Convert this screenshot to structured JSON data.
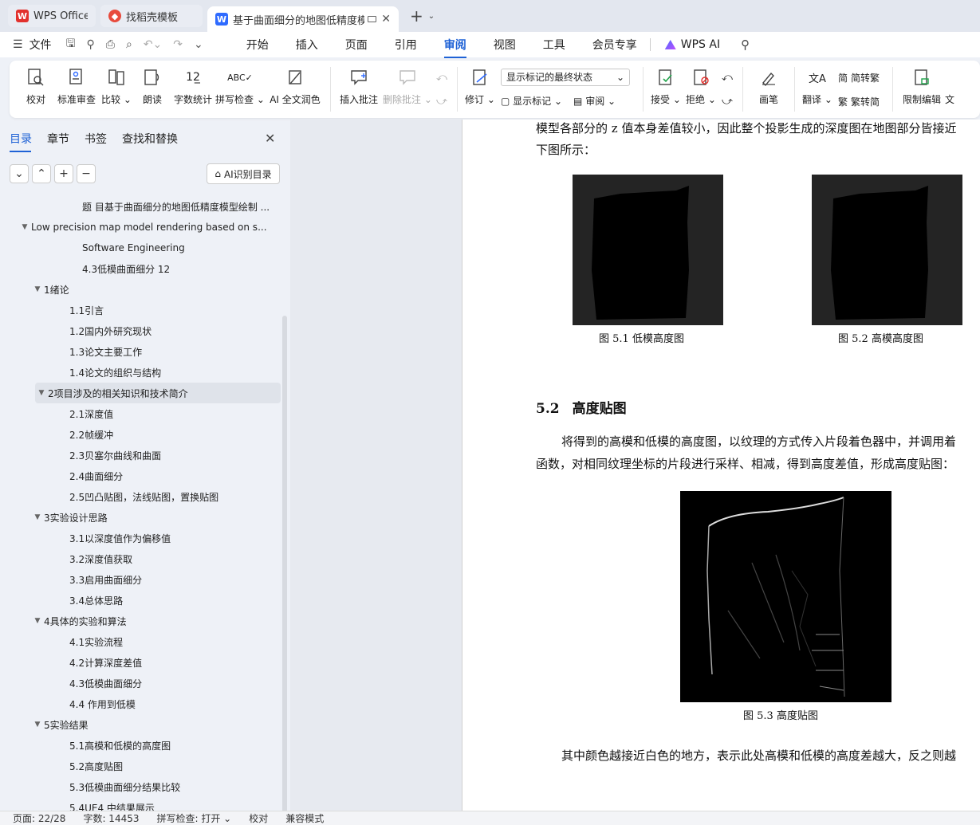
{
  "tabs": [
    {
      "label": "WPS Office"
    },
    {
      "label": "找稻壳模板"
    },
    {
      "label": "基于曲面细分的地图低精度模"
    }
  ],
  "menu": {
    "file": "文件",
    "items": [
      "开始",
      "插入",
      "页面",
      "引用",
      "审阅",
      "视图",
      "工具",
      "会员专享"
    ],
    "active": "审阅",
    "ai": "WPS AI"
  },
  "ribbon": {
    "proof": "校对",
    "std_review": "标准审查",
    "compare": "比较",
    "read": "朗读",
    "wordcount": "字数统计",
    "spell": "拼写检查",
    "ai_color": "AI 全文润色",
    "insert_comment": "插入批注",
    "delete_comment": "删除批注",
    "revise": "修订",
    "markup_state": "显示标记的最终状态",
    "show_markup": "显示标记",
    "review": "审阅",
    "accept": "接受",
    "reject": "拒绝",
    "pen": "画笔",
    "translate": "翻译",
    "to_trad": "简转繁",
    "to_simp": "繁转简",
    "restrict": "限制编辑",
    "doc_more": "文"
  },
  "nav": {
    "tabs": [
      "目录",
      "章节",
      "书签",
      "查找和替换"
    ],
    "ai_toc": "AI识别目录",
    "toc": [
      {
        "text": "题 目基于曲面细分的地图低精度模型绘制 ...",
        "indent": 103,
        "arrow": ""
      },
      {
        "text": "Low precision map model rendering based on s...",
        "indent": 39,
        "arrow": "▼"
      },
      {
        "text": "Software Engineering",
        "indent": 103,
        "arrow": ""
      },
      {
        "text": "4.3低模曲面细分  12",
        "indent": 103,
        "arrow": ""
      },
      {
        "text": "1绪论",
        "indent": 55,
        "arrow": "▼"
      },
      {
        "text": "1.1引言",
        "indent": 87,
        "arrow": ""
      },
      {
        "text": "1.2国内外研究现状",
        "indent": 87,
        "arrow": ""
      },
      {
        "text": "1.3论文主要工作",
        "indent": 87,
        "arrow": ""
      },
      {
        "text": "1.4论文的组织与结构",
        "indent": 87,
        "arrow": ""
      },
      {
        "text": "2项目涉及的相关知识和技术简介",
        "indent": 55,
        "arrow": "▼",
        "selected": true
      },
      {
        "text": "2.1深度值",
        "indent": 87,
        "arrow": ""
      },
      {
        "text": "2.2帧缓冲",
        "indent": 87,
        "arrow": ""
      },
      {
        "text": "2.3贝塞尔曲线和曲面",
        "indent": 87,
        "arrow": ""
      },
      {
        "text": "2.4曲面细分",
        "indent": 87,
        "arrow": ""
      },
      {
        "text": "2.5凹凸贴图，法线贴图，置换贴图",
        "indent": 87,
        "arrow": ""
      },
      {
        "text": "3实验设计思路",
        "indent": 55,
        "arrow": "▼"
      },
      {
        "text": "3.1以深度值作为偏移值",
        "indent": 87,
        "arrow": ""
      },
      {
        "text": "3.2深度值获取",
        "indent": 87,
        "arrow": ""
      },
      {
        "text": "3.3启用曲面细分",
        "indent": 87,
        "arrow": ""
      },
      {
        "text": "3.4总体思路",
        "indent": 87,
        "arrow": ""
      },
      {
        "text": "4具体的实验和算法",
        "indent": 55,
        "arrow": "▼"
      },
      {
        "text": "4.1实验流程",
        "indent": 87,
        "arrow": ""
      },
      {
        "text": "4.2计算深度差值",
        "indent": 87,
        "arrow": ""
      },
      {
        "text": "4.3低模曲面细分",
        "indent": 87,
        "arrow": ""
      },
      {
        "text": "4.4 作用到低模",
        "indent": 87,
        "arrow": ""
      },
      {
        "text": "5实验结果",
        "indent": 55,
        "arrow": "▼"
      },
      {
        "text": "5.1高模和低模的高度图",
        "indent": 87,
        "arrow": ""
      },
      {
        "text": "5.2高度贴图",
        "indent": 87,
        "arrow": ""
      },
      {
        "text": "5.3低模曲面细分结果比较",
        "indent": 87,
        "arrow": ""
      },
      {
        "text": "5.4UE4 中结果展示",
        "indent": 87,
        "arrow": ""
      }
    ]
  },
  "doc": {
    "line1": "模型各部分的 z 值本身差值较小，因此整个投影生成的深度图在地图部分皆接近",
    "line2": "下图所示：",
    "fig1_caption": "图 5.1   低模高度图",
    "fig2_caption": "图 5.2   高模高度图",
    "section_num": "5.2",
    "section_title": "高度贴图",
    "para1": "将得到的高模和低模的高度图，以纹理的方式传入片段着色器中，并调用着",
    "para2": "函数，对相同纹理坐标的片段进行采样、相减，得到高度差值，形成高度贴图：",
    "fig3_caption": "图 5.3   高度贴图",
    "para3": "其中颜色越接近白色的地方，表示此处高模和低模的高度差越大，反之则越"
  },
  "status": {
    "page": "页面: 22/28",
    "words": "字数: 14453",
    "spell": "拼写检查: 打开 ⌄",
    "proof": "校对",
    "compat": "兼容模式"
  }
}
